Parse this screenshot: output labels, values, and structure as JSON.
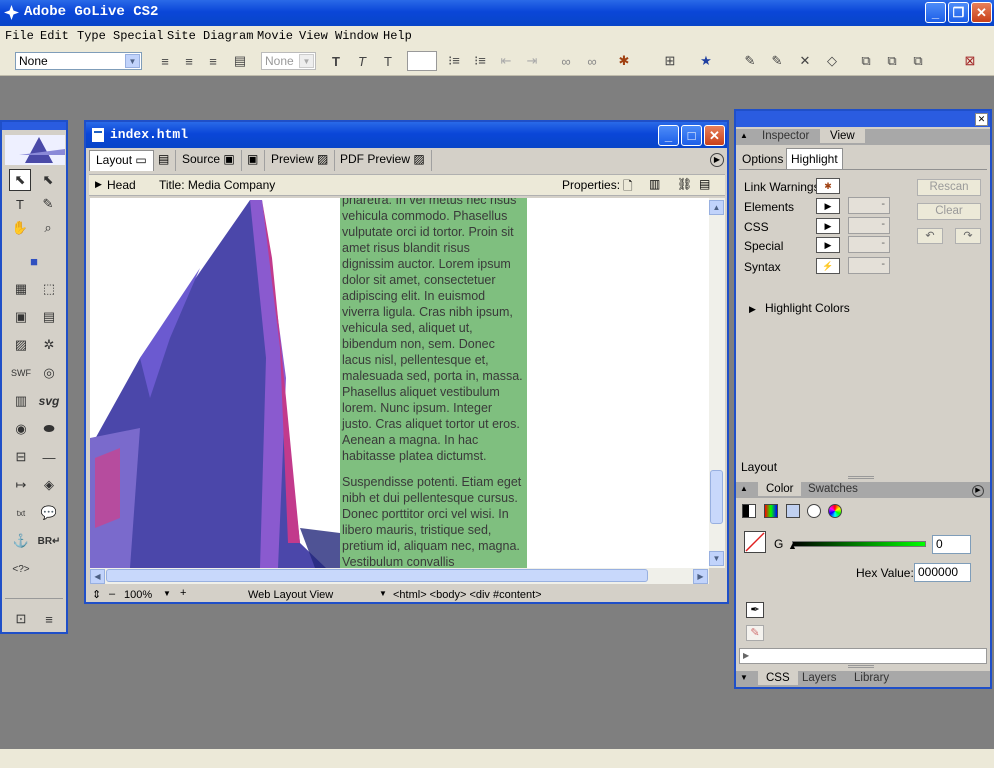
{
  "app": {
    "title": "Adobe GoLive CS2"
  },
  "menu": [
    "File",
    "Edit",
    "Type",
    "Special",
    "Site",
    "Diagram",
    "Movie",
    "View",
    "Window",
    "Help"
  ],
  "toolbar": {
    "style_select": "None",
    "font_select": "None"
  },
  "document": {
    "title": "index.html",
    "tabs": [
      "Layout",
      "Source",
      "Preview",
      "PDF Preview"
    ],
    "head_label": "Head",
    "page_title": "Title: Media Company",
    "properties_label": "Properties:",
    "para1": "pharetra. In vel metus nec risus vehicula commodo. Phasellus vulputate orci id tortor. Proin sit amet risus blandit risus dignissim auctor. Lorem ipsum dolor sit amet, consectetuer adipiscing elit. In euismod viverra ligula. Cras nibh ipsum, vehicula sed, aliquet ut, bibendum non, sem. Donec lacus nisl, pellentesque et, malesuada sed, porta in, massa. Phasellus aliquet vestibulum lorem. Nunc ipsum. Integer justo. Cras aliquet tortor ut eros. Aenean a magna. In hac habitasse platea dictumst.",
    "para2": "Suspendisse potenti. Etiam eget nibh et dui pellentesque cursus. Donec porttitor orci vel wisi. In libero mauris, tristique sed, pretium id, aliquam nec, magna. Vestibulum convallis",
    "zoom": "100%",
    "view_mode": "Web Layout View",
    "breadcrumb": "<html> <body> <div #content>"
  },
  "inspector": {
    "tabs": [
      "Inspector",
      "View"
    ],
    "subtabs": [
      "Options",
      "Highlight"
    ],
    "rows": [
      "Link Warnings",
      "Elements",
      "CSS",
      "Special",
      "Syntax"
    ],
    "dash": "-",
    "rescan": "Rescan",
    "clear": "Clear",
    "highlight_colors": "Highlight Colors",
    "layout_label": "Layout"
  },
  "color_panel": {
    "tabs": [
      "Color",
      "Swatches"
    ],
    "channel": "G",
    "channel_value": "0",
    "hex_label": "Hex Value:",
    "hex_value": "000000"
  },
  "bottom_tabs": [
    "CSS",
    "Layers",
    "Library"
  ],
  "colors": {
    "accent": "#1f4fc8",
    "green_column": "#7fbf7f",
    "building": "#4a46a8",
    "pink": "#d0408a"
  }
}
